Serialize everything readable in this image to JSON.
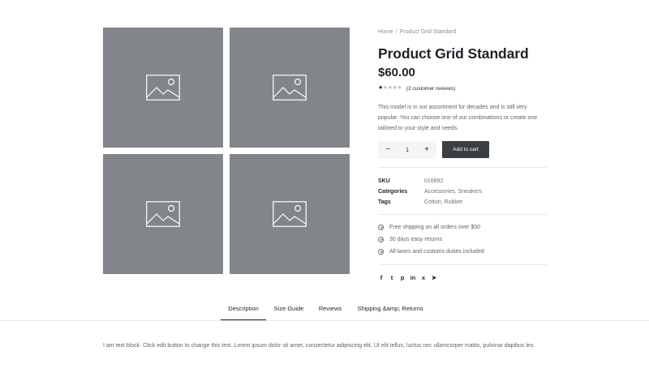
{
  "gallery": {
    "images": [
      {
        "icon": "image-placeholder-icon"
      },
      {
        "icon": "image-placeholder-icon"
      },
      {
        "icon": "image-placeholder-icon"
      },
      {
        "icon": "image-placeholder-icon"
      }
    ],
    "placeholder_color": "#82868a"
  },
  "breadcrumb": {
    "home": "Home",
    "separator": "/",
    "current": "Product Grid Standard"
  },
  "product": {
    "title": "Product Grid Standard",
    "price": "$60.00",
    "rating": 1,
    "rating_max": 5,
    "reviews": "(2 customer reviews)",
    "description": "This model is in our assortment for decades and is still very popular. You can choose one of our combinations or create one tailored to your style and needs.",
    "quantity": "1",
    "minus": "−",
    "plus": "+",
    "add_to_cart": "Add to cart"
  },
  "meta": {
    "sku_label": "SKU",
    "sku_value": "016892",
    "categories_label": "Categories",
    "categories_value": "Accessories, Sneakers",
    "tags_label": "Tags",
    "tags_value": "Cotton, Rubber"
  },
  "features": [
    "Free shipping on all orders over $50",
    "30 days easy returns",
    "All taxes and customs duties included"
  ],
  "share": {
    "icons": [
      "facebook-icon",
      "twitter-icon",
      "pinterest-icon",
      "linkedin-icon",
      "xing-icon",
      "telegram-icon"
    ],
    "glyphs": [
      "f",
      "t",
      "p",
      "in",
      "x",
      "➤"
    ]
  },
  "tabs": [
    {
      "label": "Description",
      "active": true
    },
    {
      "label": "Size Guide",
      "active": false
    },
    {
      "label": "Reviews",
      "active": false
    },
    {
      "label": "Shipping &amp; Returns",
      "active": false
    }
  ],
  "tab_content": "I am text block. Click edit button to change this text. Lorem ipsum dolor sit amet, consectetur adipiscing elit. Ut elit tellus, luctus nec ullamcorper mattis, pulvinar dapibus leo.",
  "colors": {
    "button_bg": "#3a3f44",
    "text": "#1f2328",
    "muted": "#6b7075"
  }
}
